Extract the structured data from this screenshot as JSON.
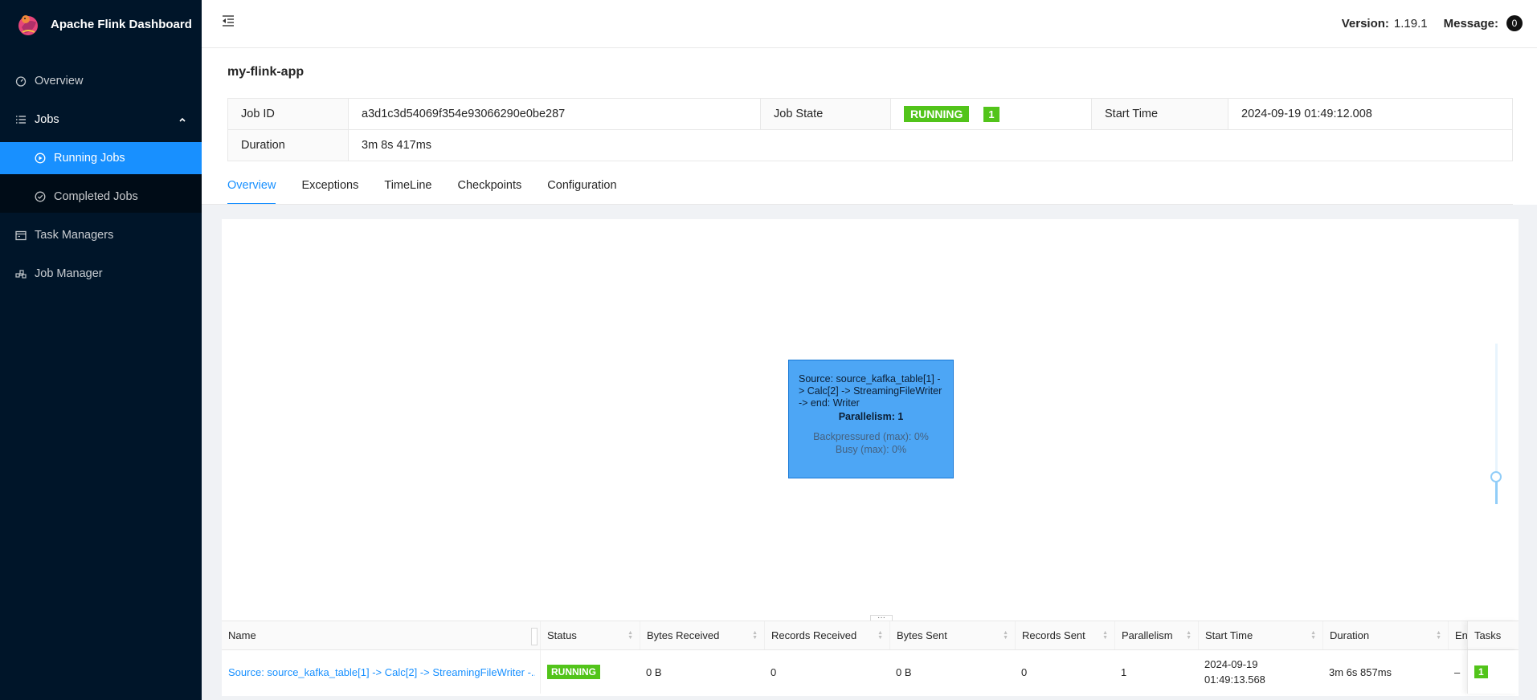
{
  "app": {
    "title": "Apache Flink Dashboard"
  },
  "header": {
    "version_label": "Version:",
    "version_value": "1.19.1",
    "message_label": "Message:",
    "message_count": "0"
  },
  "sidebar": {
    "items": [
      {
        "label": "Overview",
        "icon": "dashboard-icon"
      },
      {
        "label": "Jobs",
        "icon": "list-icon"
      },
      {
        "label": "Running Jobs",
        "icon": "play-circle-icon"
      },
      {
        "label": "Completed Jobs",
        "icon": "check-circle-icon"
      },
      {
        "label": "Task Managers",
        "icon": "schedule-icon"
      },
      {
        "label": "Job Manager",
        "icon": "cluster-icon"
      }
    ]
  },
  "job": {
    "name": "my-flink-app",
    "id_label": "Job ID",
    "id": "a3d1c3d54069f354e93066290e0be287",
    "state_label": "Job State",
    "state": "RUNNING",
    "state_count": "1",
    "start_label": "Start Time",
    "start": "2024-09-19 01:49:12.008",
    "duration_label": "Duration",
    "duration": "3m 8s 417ms"
  },
  "tabs": [
    "Overview",
    "Exceptions",
    "TimeLine",
    "Checkpoints",
    "Configuration"
  ],
  "graph": {
    "node_title": "Source: source_kafka_table[1] -> Calc[2] -> StreamingFileWriter -> end: Writer",
    "node_parallelism": "Parallelism: 1",
    "node_backpressure": "Backpressured (max): 0%",
    "node_busy": "Busy (max): 0%",
    "zoom_level": 0.18
  },
  "table": {
    "columns": [
      "Name",
      "Status",
      "Bytes Received",
      "Records Received",
      "Bytes Sent",
      "Records Sent",
      "Parallelism",
      "Start Time",
      "Duration",
      "En",
      "Tasks"
    ],
    "row": {
      "name": "Source: source_kafka_table[1] -> Calc[2] -> StreamingFileWriter -...",
      "status": "RUNNING",
      "bytes_received": "0 B",
      "records_received": "0",
      "bytes_sent": "0 B",
      "records_sent": "0",
      "parallelism": "1",
      "start_time_date": "2024-09-19",
      "start_time_time": "01:49:13.568",
      "duration": "3m 6s 857ms",
      "end": "–",
      "tasks": "1"
    }
  },
  "colors": {
    "sidebar": "#001529",
    "accent": "#1890ff",
    "running": "#52c41a",
    "node": "#4da6f5"
  }
}
